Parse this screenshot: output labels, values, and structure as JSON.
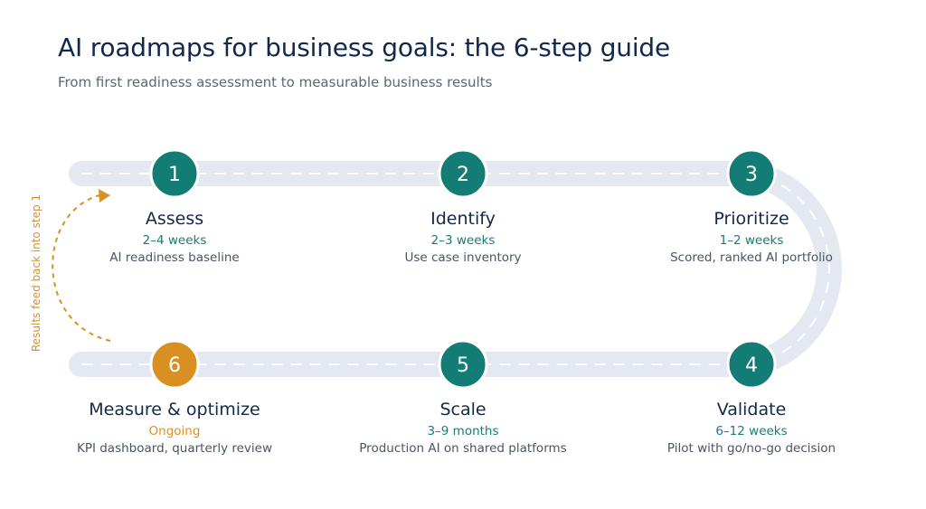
{
  "header": {
    "title": "AI roadmaps for business goals: the 6-step guide",
    "subtitle": "From first readiness assessment to measurable business results"
  },
  "colors": {
    "road": "#e3e8f1",
    "step_teal": "#137c74",
    "step_amber": "#d99023",
    "title_navy": "#14284b"
  },
  "steps": [
    {
      "number": "1",
      "title": "Assess",
      "duration": "2–4 weeks",
      "description": "AI readiness baseline"
    },
    {
      "number": "2",
      "title": "Identify",
      "duration": "2–3 weeks",
      "description": "Use case inventory"
    },
    {
      "number": "3",
      "title": "Prioritize",
      "duration": "1–2 weeks",
      "description": "Scored, ranked AI portfolio"
    },
    {
      "number": "4",
      "title": "Validate",
      "duration": "6–12 weeks",
      "description": "Pilot with go/no-go decision"
    },
    {
      "number": "5",
      "title": "Scale",
      "duration": "3–9 months",
      "description": "Production AI on shared platforms"
    },
    {
      "number": "6",
      "title": "Measure & optimize",
      "duration": "Ongoing",
      "description": "KPI dashboard, quarterly review"
    }
  ],
  "feedback": {
    "label": "Results feed back into step 1"
  }
}
